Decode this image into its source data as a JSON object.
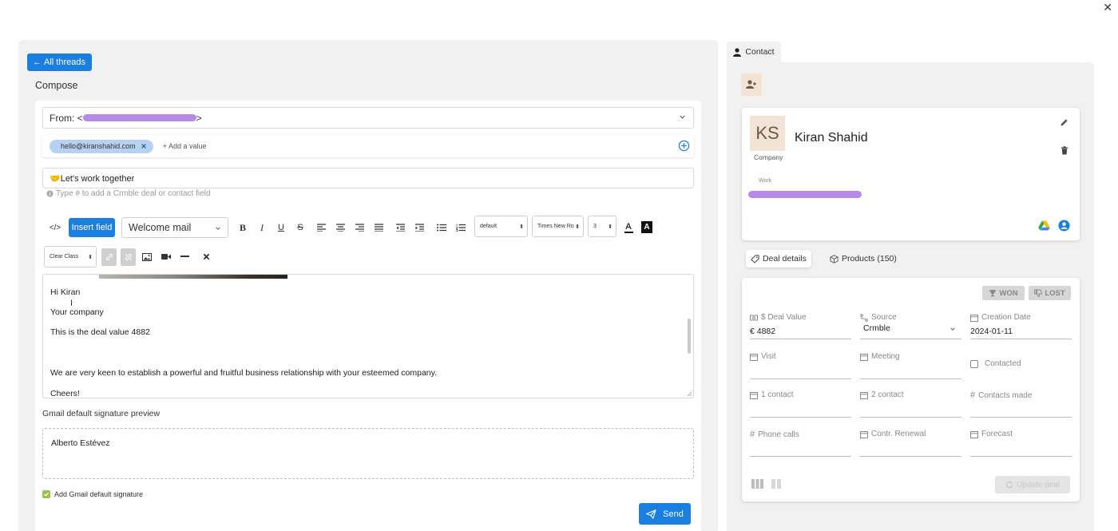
{
  "window": {
    "close_icon": "close-icon"
  },
  "compose": {
    "back_label": "All threads",
    "title": "Compose",
    "from_prefix": "From: <",
    "from_suffix": ">",
    "to_chip": "hello@kiranshahid.com",
    "add_value": "+ Add a value",
    "subject": "🤝Let's work together",
    "hint": "Type # to add a Crmble deal or contact field",
    "toolbar": {
      "insert_field": "Insert field",
      "template_value": "Welcome mail",
      "style_value": "default",
      "font_value": "Times New Ro",
      "size_value": "3",
      "clear_class": "Clear Class"
    },
    "body_lines": [
      "Hi Kiran",
      "Your company",
      "This is the deal value 4882",
      "We are very keen to establish a powerful and fruitful business relationship with your esteemed company.",
      "Cheers!"
    ],
    "signature_label": "Gmail default signature preview",
    "signature_text": "Alberto Estévez",
    "add_signature_label": "Add Gmail default signature",
    "send_label": "Send"
  },
  "contact": {
    "tab_label": "Contact",
    "initials": "KS",
    "name": "Kiran Shahid",
    "company_label": "Company",
    "work_label": "Work",
    "subtabs": [
      "Deal details",
      "Products (150)"
    ],
    "won_label": "WON",
    "lost_label": "LOST",
    "fields": {
      "deal_value_label": "$ Deal Value",
      "deal_value": "€ 4882",
      "source_label": "Source",
      "source_value": "Crmble",
      "creation_date_label": "Creation Date",
      "creation_date": "2024-01-11",
      "visit_label": "Visit",
      "meeting_label": "Meeting",
      "contacted_label": "Contacted",
      "one_contact_label": "1 contact",
      "two_contact_label": "2 contact",
      "contacts_made_label": "Contacts made",
      "phone_calls_label": "Phone calls",
      "contr_renewal_label": "Contr. Renewal",
      "forecast_label": "Forecast"
    },
    "update_label": "Update deal"
  }
}
